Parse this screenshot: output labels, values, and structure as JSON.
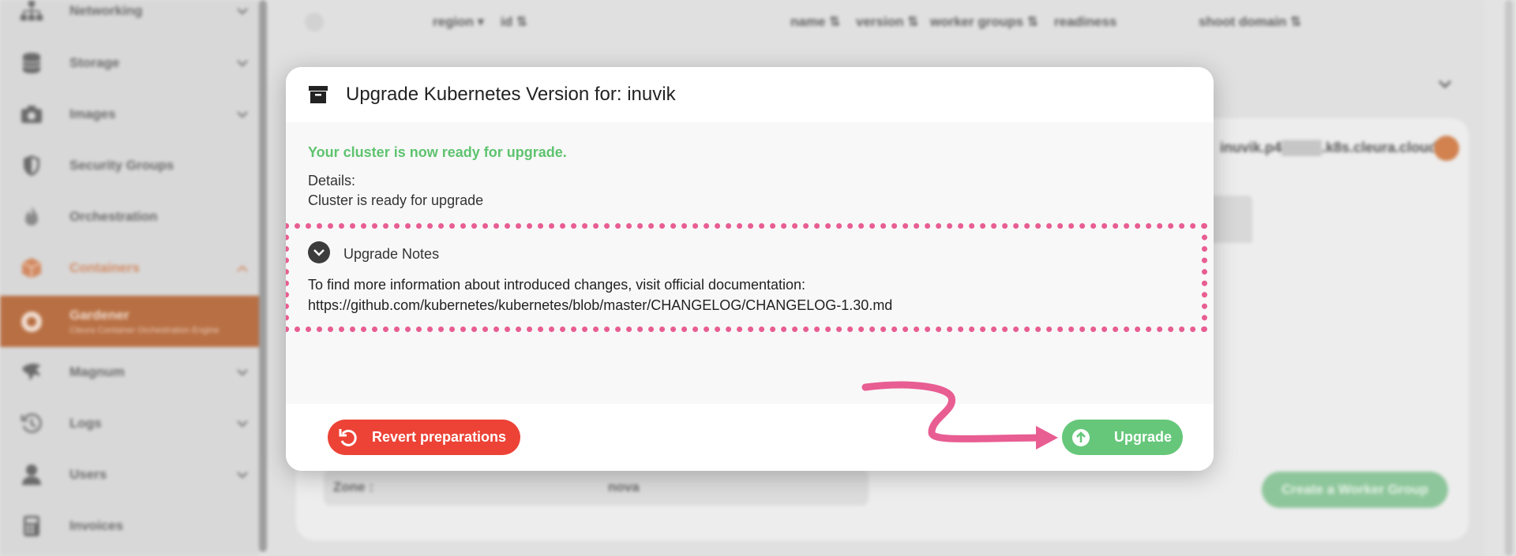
{
  "colors": {
    "accent_orange": "#b86f43",
    "success_green": "#5ec36f",
    "danger_red": "#ec4336",
    "highlight_pink": "#e85d92"
  },
  "sidebar": {
    "items": [
      {
        "label": "Networking",
        "icon": "network-icon"
      },
      {
        "label": "Storage",
        "icon": "database-icon"
      },
      {
        "label": "Images",
        "icon": "camera-icon"
      },
      {
        "label": "Security Groups",
        "icon": "shield-icon"
      },
      {
        "label": "Orchestration",
        "icon": "flame-icon"
      },
      {
        "label": "Containers",
        "icon": "cube-icon"
      },
      {
        "label": "Gardener",
        "sub": "Cleura Container Orchestration Engine",
        "icon": "gardener-icon"
      },
      {
        "label": "Magnum",
        "icon": "magnum-icon"
      },
      {
        "label": "Logs",
        "icon": "history-icon"
      },
      {
        "label": "Users",
        "icon": "user-icon"
      },
      {
        "label": "Invoices",
        "icon": "calculator-icon"
      }
    ]
  },
  "table": {
    "headers": {
      "region": "region",
      "id": "id",
      "name": "name",
      "version": "version",
      "worker_groups": "worker groups",
      "readiness": "readiness",
      "shoot_domain": "shoot domain"
    }
  },
  "background": {
    "shoot_domain_value": "inuvik.p4▒▒▒▒.k8s.cleura.cloud",
    "zone_label": "Zone :",
    "zone_value": "nova",
    "create_worker_group": "Create a Worker Group"
  },
  "dialog": {
    "title": "Upgrade Kubernetes Version for: inuvik",
    "ready_message": "Your cluster is now ready for upgrade.",
    "details_label": "Details:",
    "details_value": "Cluster is ready for upgrade",
    "notes_title": "Upgrade Notes",
    "notes_text": "To find more information about introduced changes, visit official documentation:",
    "notes_url": "https://github.com/kubernetes/kubernetes/blob/master/CHANGELOG/CHANGELOG-1.30.md",
    "revert_label": "Revert preparations",
    "upgrade_label": "Upgrade"
  }
}
